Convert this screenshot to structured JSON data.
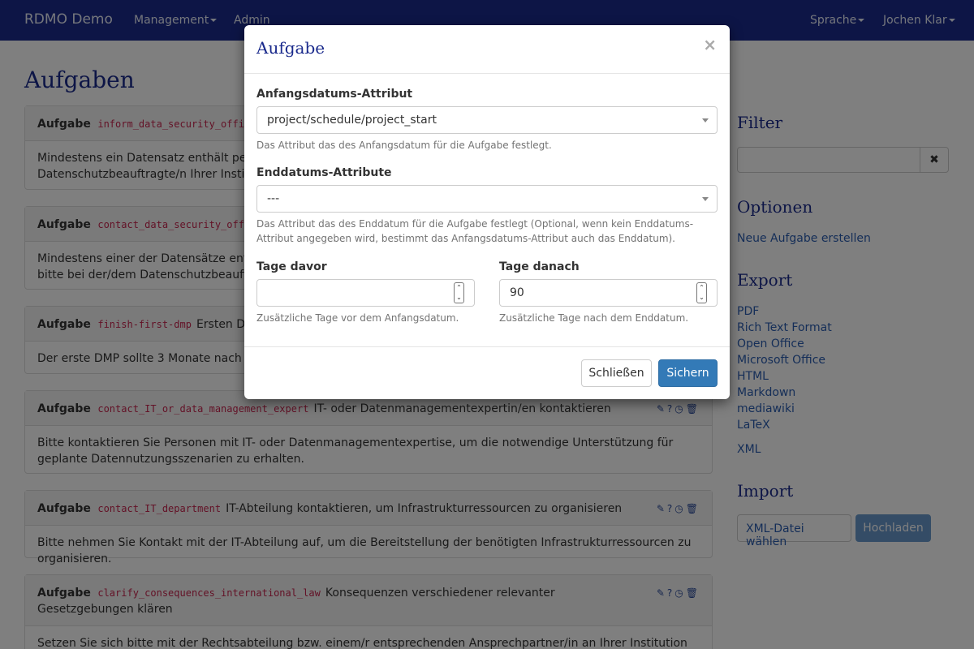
{
  "navbar": {
    "brand": "RDMO Demo",
    "management": "Management",
    "admin": "Admin",
    "language": "Sprache",
    "user": "Jochen Klar"
  },
  "page": {
    "title": "Aufgaben"
  },
  "task_label": "Aufgabe",
  "tasks": [
    {
      "key": "inform_data_security_offi",
      "title": "",
      "body": "Mindestens ein Datensatz enthält person\nDatenschutzbeauftragte/n Ihrer Institution"
    },
    {
      "key": "contact_data_security_offi",
      "title": "",
      "body": "Mindestens einer der Datensätze enthält\nbitte bei der/dem Datenschutzbeauftragt"
    },
    {
      "key": "finish-first-dmp",
      "title": "Ersten DM",
      "body": "Der erste DMP sollte 3 Monate nach Proj"
    },
    {
      "key": "contact_IT_or_data_management_expert",
      "title": "IT- oder Datenmanagementexpertin/en kontaktieren",
      "body": "Bitte kontaktieren Sie Personen mit IT- oder Datenmanagementexpertise, um die notwendige Unterstützung für geplante Datennutzungsszenarien zu erhalten."
    },
    {
      "key": "contact_IT_department",
      "title": "IT-Abteilung kontaktieren, um Infrastrukturressourcen zu organisieren",
      "body": "Bitte nehmen Sie Kontakt mit der IT-Abteilung auf, um die Bereitstellung der benötigten Infrastrukturressourcen zu organisieren."
    },
    {
      "key": "clarify_consequences_international_law",
      "title": "Konsequenzen verschiedener relevanter Gesetzgebungen klären",
      "body": "Setzen Sie sich bitte mit der Rechtsabteilung bzw. einem/r entsprechenden Ansprechpartner/in an Ihrer Institution in"
    }
  ],
  "sidebar": {
    "filter_title": "Filter",
    "filter_clear": "✖",
    "options_title": "Optionen",
    "new_task": "Neue Aufgabe erstellen",
    "export_title": "Export",
    "export_links": [
      "PDF",
      "Rich Text Format",
      "Open Office",
      "Microsoft Office",
      "HTML",
      "Markdown",
      "mediawiki",
      "LaTeX",
      "XML"
    ],
    "import_title": "Import",
    "import_file": "XML-Datei wählen",
    "import_button": "Hochladen"
  },
  "modal": {
    "title": "Aufgabe",
    "close": "×",
    "start_label": "Anfangsdatums-Attribut",
    "start_value": "project/schedule/project_start",
    "start_help": "Das Attribut das des Anfangsdatum für die Aufgabe festlegt.",
    "end_label": "Enddatums-Attribute",
    "end_value": "---",
    "end_help": "Das Attribut das des Enddatum für die Aufgabe festlegt (Optional, wenn kein Enddatums-Attribut angegeben wird, bestimmt das Anfangsdatums-Attribut auch das Enddatum).",
    "days_before_label": "Tage davor",
    "days_before_value": "",
    "days_before_help": "Zusätzliche Tage vor dem Anfangsdatum.",
    "days_after_label": "Tage danach",
    "days_after_value": "90",
    "days_after_help": "Zusätzliche Tage nach dem Enddatum.",
    "close_button": "Schließen",
    "save_button": "Sichern"
  },
  "icons": {
    "task_actions": [
      "pencil-icon",
      "question-icon",
      "clock-icon",
      "trash-icon"
    ]
  }
}
